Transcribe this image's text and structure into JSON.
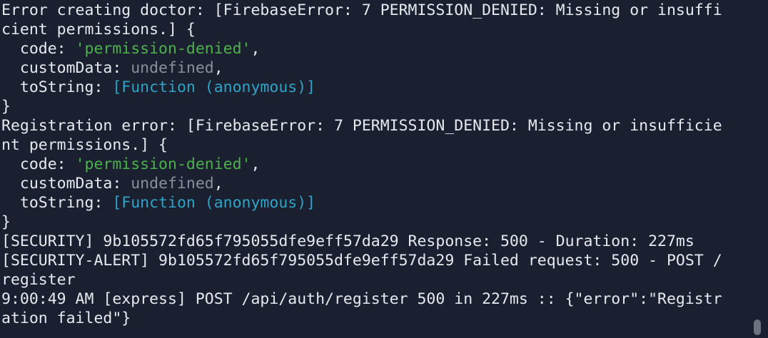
{
  "terminal": {
    "lines": [
      [
        {
          "t": "Error creating doctor: [FirebaseError: 7 PERMISSION_DENIED: Missing or insuffi",
          "c": "plain"
        }
      ],
      [
        {
          "t": "cient permissions.] {",
          "c": "plain"
        }
      ],
      [
        {
          "t": "  code: ",
          "c": "plain"
        },
        {
          "t": "'permission-denied'",
          "c": "str"
        },
        {
          "t": ",",
          "c": "plain"
        }
      ],
      [
        {
          "t": "  customData: ",
          "c": "plain"
        },
        {
          "t": "undefined",
          "c": "undef"
        },
        {
          "t": ",",
          "c": "plain"
        }
      ],
      [
        {
          "t": "  toString: ",
          "c": "plain"
        },
        {
          "t": "[Function (anonymous)]",
          "c": "fn"
        }
      ],
      [
        {
          "t": "}",
          "c": "plain"
        }
      ],
      [
        {
          "t": "Registration error: [FirebaseError: 7 PERMISSION_DENIED: Missing or insufficie",
          "c": "plain"
        }
      ],
      [
        {
          "t": "nt permissions.] {",
          "c": "plain"
        }
      ],
      [
        {
          "t": "  code: ",
          "c": "plain"
        },
        {
          "t": "'permission-denied'",
          "c": "str"
        },
        {
          "t": ",",
          "c": "plain"
        }
      ],
      [
        {
          "t": "  customData: ",
          "c": "plain"
        },
        {
          "t": "undefined",
          "c": "undef"
        },
        {
          "t": ",",
          "c": "plain"
        }
      ],
      [
        {
          "t": "  toString: ",
          "c": "plain"
        },
        {
          "t": "[Function (anonymous)]",
          "c": "fn"
        }
      ],
      [
        {
          "t": "}",
          "c": "plain"
        }
      ],
      [
        {
          "t": "[SECURITY] 9b105572fd65f795055dfe9eff57da29 Response: 500 - Duration: 227ms",
          "c": "plain"
        }
      ],
      [
        {
          "t": "[SECURITY-ALERT] 9b105572fd65f795055dfe9eff57da29 Failed request: 500 - POST /",
          "c": "plain"
        }
      ],
      [
        {
          "t": "register",
          "c": "plain"
        }
      ],
      [
        {
          "t": "9:00:49 AM [express] POST /api/auth/register 500 in 227ms :: {\"error\":\"Registr",
          "c": "plain"
        }
      ],
      [
        {
          "t": "ation failed\"}",
          "c": "plain"
        }
      ]
    ]
  },
  "colors": {
    "background": "#1b2030",
    "text": "#e6e9ef",
    "string": "#4cb04c",
    "undefined": "#8a8f98",
    "function": "#2fa3c7",
    "scrollbar_thumb": "#6b7280"
  }
}
